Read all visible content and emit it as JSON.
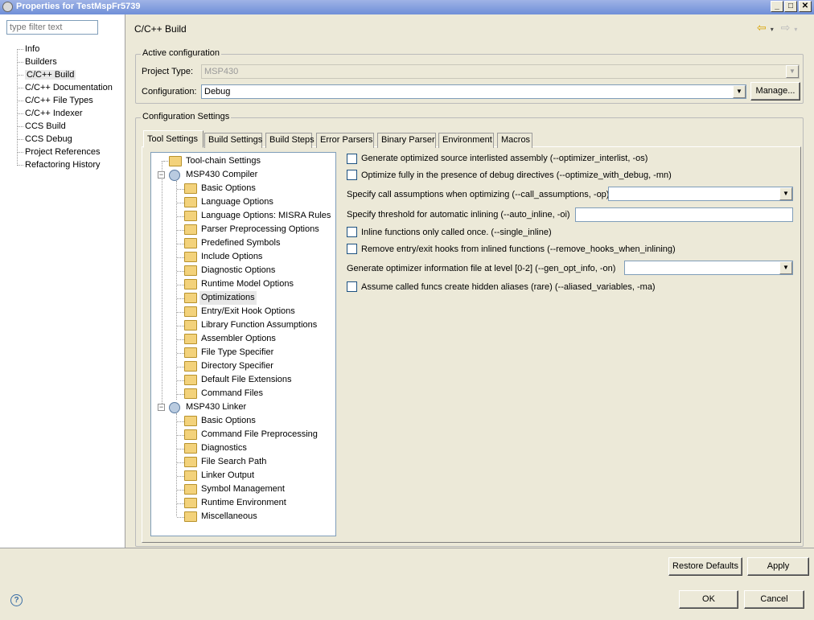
{
  "window": {
    "title": "Properties for TestMspFr5739"
  },
  "sidebar": {
    "filter_placeholder": "type filter text",
    "items": [
      "Info",
      "Builders",
      "C/C++ Build",
      "C/C++ Documentation",
      "C/C++ File Types",
      "C/C++ Indexer",
      "CCS Build",
      "CCS Debug",
      "Project References",
      "Refactoring History"
    ],
    "selected": "C/C++ Build"
  },
  "page": {
    "title": "C/C++ Build"
  },
  "active_config": {
    "group_label": "Active configuration",
    "project_type_label": "Project Type:",
    "project_type_value": "MSP430",
    "configuration_label": "Configuration:",
    "configuration_value": "Debug",
    "manage_label": "Manage..."
  },
  "config_settings": {
    "group_label": "Configuration Settings"
  },
  "tabs": [
    "Tool Settings",
    "Build Settings",
    "Build Steps",
    "Error Parsers",
    "Binary Parser",
    "Environment",
    "Macros"
  ],
  "active_tab": "Tool Settings",
  "tree": {
    "toolchain": "Tool-chain Settings",
    "compiler": {
      "label": "MSP430 Compiler",
      "children": [
        "Basic Options",
        "Language Options",
        "Language Options: MISRA Rules",
        "Parser Preprocessing Options",
        "Predefined Symbols",
        "Include Options",
        "Diagnostic Options",
        "Runtime Model Options",
        "Optimizations",
        "Entry/Exit Hook Options",
        "Library Function Assumptions",
        "Assembler Options",
        "File Type Specifier",
        "Directory Specifier",
        "Default File Extensions",
        "Command Files"
      ]
    },
    "linker": {
      "label": "MSP430 Linker",
      "children": [
        "Basic Options",
        "Command File Preprocessing",
        "Diagnostics",
        "File Search Path",
        "Linker Output",
        "Symbol Management",
        "Runtime Environment",
        "Miscellaneous"
      ]
    },
    "selected": "Optimizations"
  },
  "options": {
    "interlist": "Generate optimized source interlisted assembly (--optimizer_interlist, -os)",
    "optimize_debug": "Optimize fully in the presence of debug directives (--optimize_with_debug, -mn)",
    "call_assumptions": "Specify call assumptions when optimizing (--call_assumptions, -op)",
    "auto_inline": "Specify threshold for automatic inlining (--auto_inline, -oi)",
    "single_inline": "Inline functions only called once. (--single_inline)",
    "remove_hooks": "Remove entry/exit hooks from inlined functions (--remove_hooks_when_inlining)",
    "gen_opt_info": "Generate optimizer information file at level [0-2] (--gen_opt_info, -on)",
    "aliased": "Assume called funcs create hidden aliases (rare) (--aliased_variables, -ma)",
    "call_assumptions_value": "",
    "auto_inline_value": "",
    "gen_opt_info_value": ""
  },
  "buttons": {
    "restore": "Restore Defaults",
    "apply": "Apply",
    "ok": "OK",
    "cancel": "Cancel"
  }
}
